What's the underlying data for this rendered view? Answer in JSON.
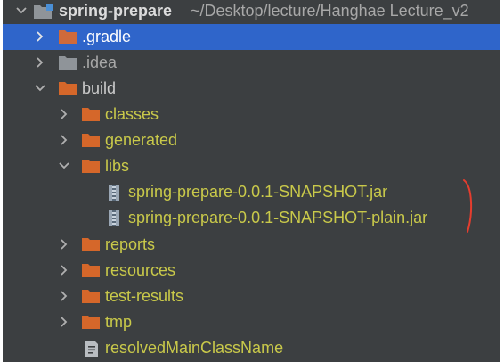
{
  "tree": {
    "root": {
      "name": "spring-prepare",
      "path": "~/Desktop/lecture/Hanghae Lecture_v2"
    },
    "items": [
      {
        "label": ".gradle"
      },
      {
        "label": ".idea"
      },
      {
        "label": "build"
      },
      {
        "label": "classes"
      },
      {
        "label": "generated"
      },
      {
        "label": "libs"
      },
      {
        "label": "spring-prepare-0.0.1-SNAPSHOT.jar"
      },
      {
        "label": "spring-prepare-0.0.1-SNAPSHOT-plain.jar"
      },
      {
        "label": "reports"
      },
      {
        "label": "resources"
      },
      {
        "label": "test-results"
      },
      {
        "label": "tmp"
      },
      {
        "label": "resolvedMainClassName"
      }
    ]
  },
  "colors": {
    "background": "#3c3f41",
    "selection": "#2f65ca",
    "folder": "#d5672a",
    "excluded_folder": "#cf6a3b",
    "idea_folder": "#8f9499",
    "highlight_text": "#c9c94a",
    "annotation_mark": "#e53d2e"
  },
  "icons": {
    "expanded": "chevron-down-icon",
    "collapsed": "chevron-right-icon",
    "folder": "folder-icon",
    "jar": "jar-icon",
    "file": "text-file-icon"
  }
}
